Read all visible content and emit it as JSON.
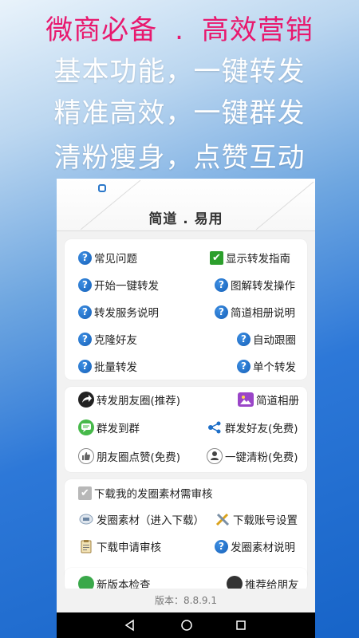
{
  "promo": {
    "line1_left": "微商必备",
    "line1_dot": ".",
    "line1_right": "高效营销",
    "line2": "基本功能，一键转发",
    "line3": "精准高效，一键群发",
    "line4": "清粉瘦身，点赞互动"
  },
  "app": {
    "title": "简道 . 易用",
    "version": "版本：8.8.9.1"
  },
  "card1": {
    "left": [
      "常见问题",
      "开始一键转发",
      "转发服务说明",
      "克隆好友",
      "批量转发"
    ],
    "right": [
      "显示转发指南",
      "图解转发操作",
      "简道相册说明",
      "自动跟圈",
      "单个转发"
    ]
  },
  "card2": {
    "left": [
      "转发朋友圈(推荐)",
      "群发到群",
      "朋友圈点赞(免费)"
    ],
    "right": [
      "简道相册",
      "群发好友(免费)",
      "一键清粉(免费)"
    ]
  },
  "card3": {
    "review": "下载我的发圈素材需审核",
    "material": "发圈素材（进入下载）",
    "account": "下载账号设置",
    "apply": "下载申请审核",
    "material_help": "发圈素材说明"
  },
  "card4": {
    "left": "新版本检查",
    "right": "推荐给朋友"
  },
  "colors": {
    "accent_pink": "#e8196e",
    "help_blue": "#1e6fc8",
    "check_green": "#2c9f2c"
  },
  "icons": {
    "help": "question-circle",
    "back": "triangle-left",
    "home": "circle",
    "recent": "square"
  }
}
